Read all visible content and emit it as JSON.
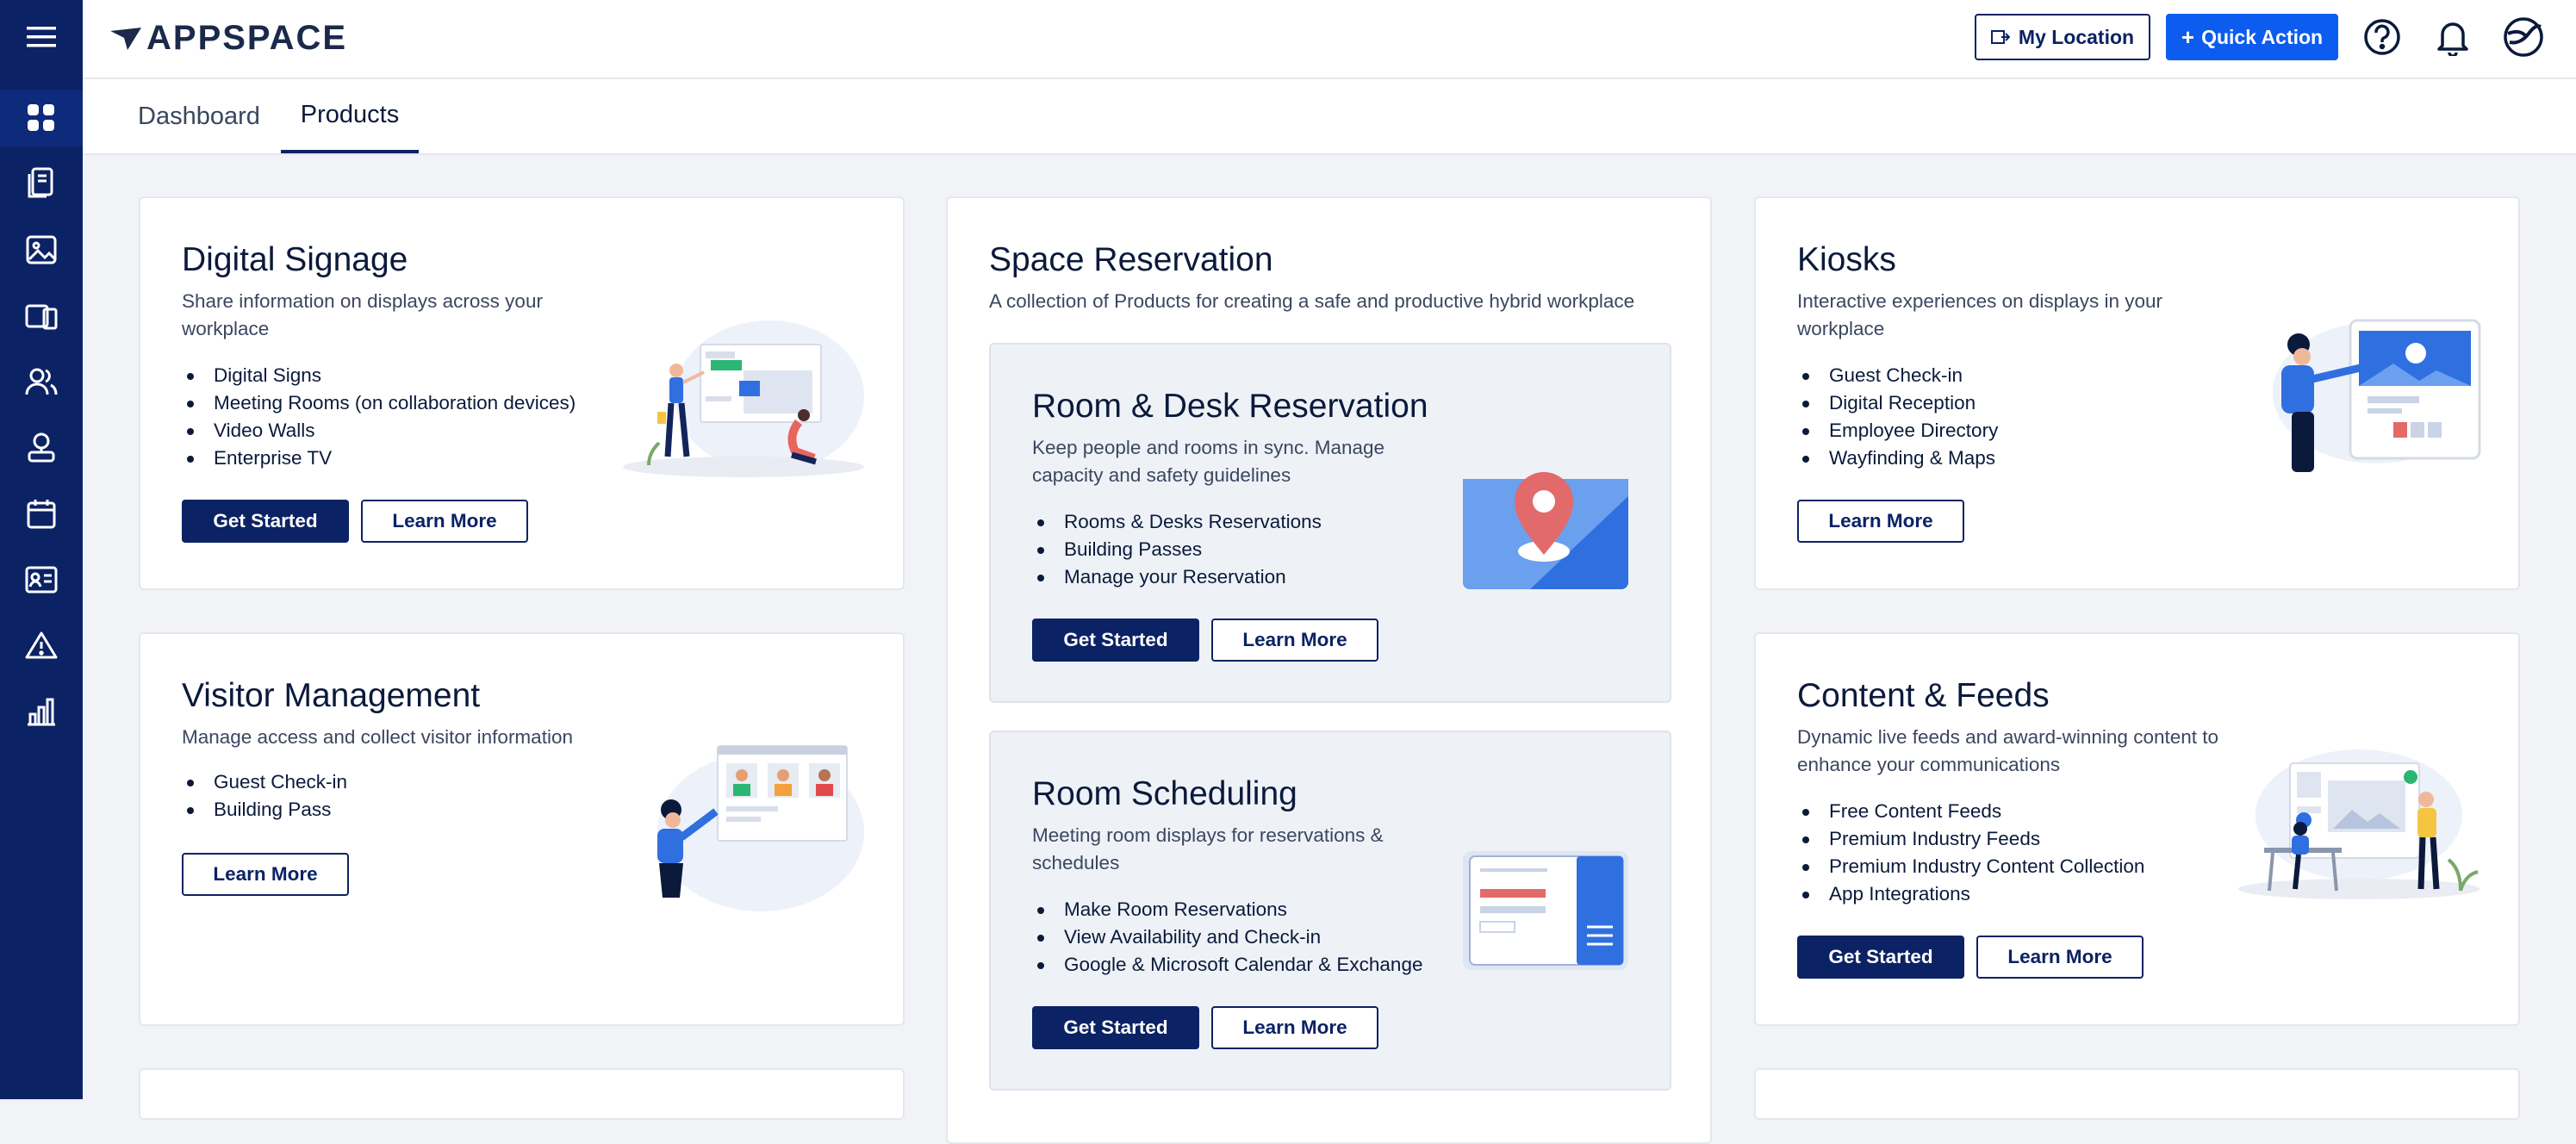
{
  "app": {
    "logo_text": "APPSPACE"
  },
  "topbar": {
    "my_location_label": "My Location",
    "quick_action_label": "Quick Action",
    "quick_action_prefix": "+"
  },
  "sidebar": {
    "items": [
      {
        "icon": "menu-icon"
      },
      {
        "icon": "dashboard-grid-icon"
      },
      {
        "icon": "devices-icon"
      },
      {
        "icon": "image-library-icon"
      },
      {
        "icon": "channels-icon"
      },
      {
        "icon": "users-icon"
      },
      {
        "icon": "visitor-badge-icon"
      },
      {
        "icon": "calendar-icon"
      },
      {
        "icon": "id-card-icon"
      },
      {
        "icon": "alert-triangle-icon"
      },
      {
        "icon": "analytics-chart-icon"
      }
    ]
  },
  "tabs": [
    {
      "label": "Dashboard",
      "active": false
    },
    {
      "label": "Products",
      "active": true
    }
  ],
  "cards": {
    "digital_signage": {
      "title": "Digital Signage",
      "desc": "Share information on displays across your workplace",
      "items": [
        "Digital Signs",
        "Meeting Rooms (on collaboration devices)",
        "Video Walls",
        "Enterprise TV"
      ],
      "get_started": "Get Started",
      "learn_more": "Learn More"
    },
    "visitor_management": {
      "title": "Visitor Management",
      "desc": "Manage access and collect visitor information",
      "items": [
        "Guest Check-in",
        "Building Pass"
      ],
      "learn_more": "Learn More"
    },
    "space_reservation": {
      "title": "Space Reservation",
      "desc": "A collection of Products for creating a safe and productive hybrid workplace",
      "room_desk": {
        "title": "Room & Desk Reservation",
        "desc": "Keep people and rooms in sync. Manage capacity and safety guidelines",
        "items": [
          "Rooms & Desks Reservations",
          "Building Passes",
          "Manage your Reservation"
        ],
        "get_started": "Get Started",
        "learn_more": "Learn More"
      },
      "room_scheduling": {
        "title": "Room Scheduling",
        "desc": "Meeting room displays for reservations & schedules",
        "items": [
          "Make Room Reservations",
          "View Availability and Check-in",
          "Google & Microsoft Calendar & Exchange"
        ],
        "get_started": "Get Started",
        "learn_more": "Learn More"
      }
    },
    "kiosks": {
      "title": "Kiosks",
      "desc": "Interactive experiences on displays in your workplace",
      "items": [
        "Guest Check-in",
        "Digital Reception",
        "Employee Directory",
        "Wayfinding & Maps"
      ],
      "learn_more": "Learn More"
    },
    "content_feeds": {
      "title": "Content & Feeds",
      "desc": "Dynamic live feeds and award-winning content to enhance your communications",
      "items": [
        "Free Content Feeds",
        "Premium Industry Feeds",
        "Premium Industry Content Collection",
        "App Integrations"
      ],
      "get_started": "Get Started",
      "learn_more": "Learn More"
    }
  },
  "colors": {
    "navy": "#0b2264",
    "accent": "#0d5cf0",
    "panel": "#eef2f7"
  }
}
